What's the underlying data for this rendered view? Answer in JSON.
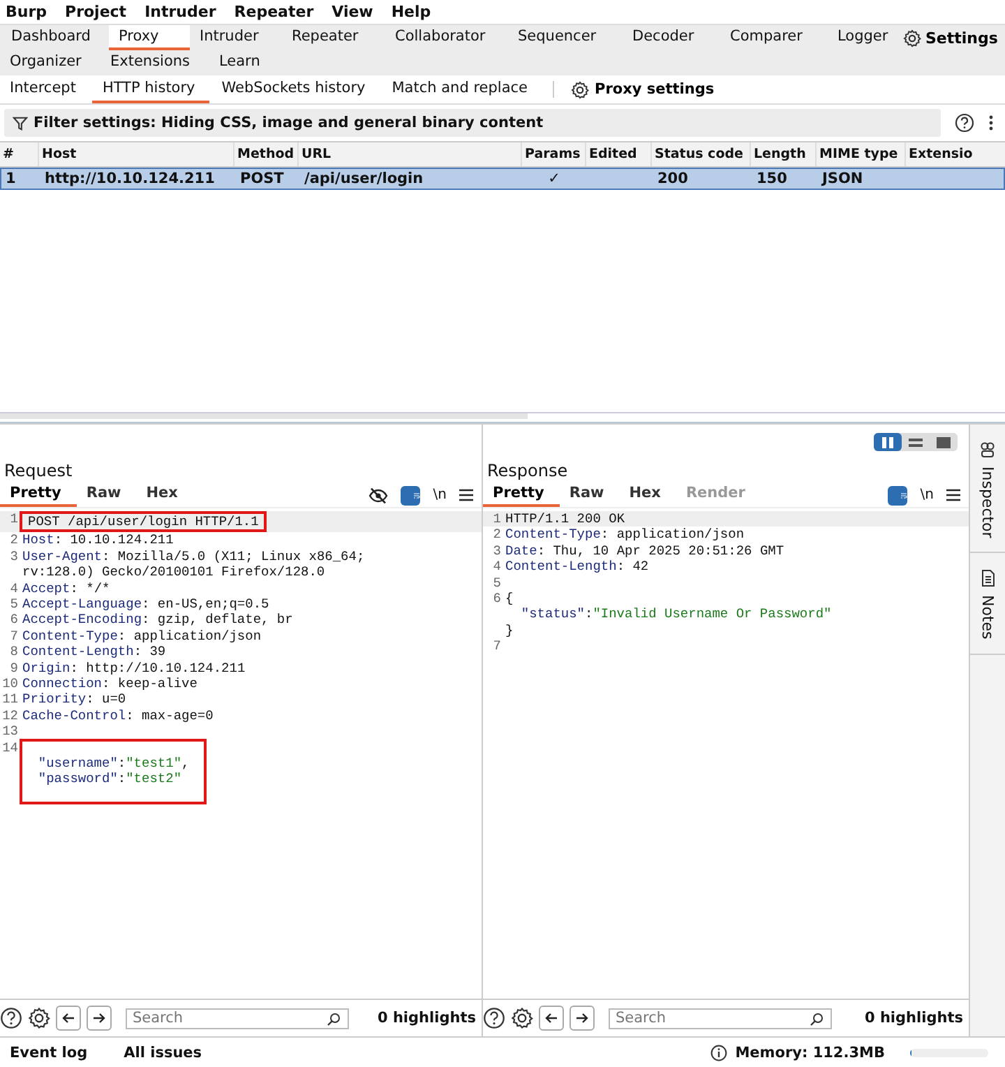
{
  "menu": [
    "Burp",
    "Project",
    "Intruder",
    "Repeater",
    "View",
    "Help"
  ],
  "tab_rows": [
    [
      {
        "label": "Dashboard",
        "selected": false
      },
      {
        "label": "Proxy",
        "selected": true
      },
      {
        "label": "Intruder",
        "selected": false
      },
      {
        "label": "Repeater",
        "selected": false
      },
      {
        "label": "Collaborator",
        "selected": false
      },
      {
        "label": "Sequencer",
        "selected": false
      },
      {
        "label": "Decoder",
        "selected": false
      },
      {
        "label": "Comparer",
        "selected": false
      },
      {
        "label": "Logger",
        "selected": false
      }
    ],
    [
      {
        "label": "Organizer",
        "selected": false
      },
      {
        "label": "Extensions",
        "selected": false
      },
      {
        "label": "Learn",
        "selected": false
      }
    ]
  ],
  "settings_button": {
    "label": "Settings"
  },
  "sub_tabs": [
    {
      "label": "Intercept",
      "selected": false
    },
    {
      "label": "HTTP history",
      "selected": true
    },
    {
      "label": "WebSockets history",
      "selected": false
    },
    {
      "label": "Match and replace",
      "selected": false
    }
  ],
  "proxy_settings_button": {
    "label": "Proxy settings"
  },
  "filter": {
    "text": "Filter settings: Hiding CSS, image and general binary content"
  },
  "table": {
    "columns": [
      "#",
      "Host",
      "Method",
      "URL",
      "Params",
      "Edited",
      "Status code",
      "Length",
      "MIME type",
      "Extensio"
    ],
    "rows": [
      {
        "selected": true,
        "cells": [
          "1",
          "http://10.10.124.211",
          "POST",
          "/api/user/login",
          "✓",
          "",
          "200",
          "150",
          "JSON",
          ""
        ]
      }
    ]
  },
  "panes": [
    {
      "title": "Request",
      "tabs": [
        {
          "label": "Pretty",
          "selected": true,
          "disabled": false
        },
        {
          "label": "Raw",
          "selected": false,
          "disabled": false
        },
        {
          "label": "Hex",
          "selected": false,
          "disabled": false
        }
      ],
      "hide_icon": true,
      "newline_label": "\\n",
      "lines": [
        {
          "n": "1",
          "current": true,
          "boxed": true,
          "rows": [
            {
              "indented": false,
              "segments": [
                {
                  "kind": "plain",
                  "text": "POST /api/user/login HTTP/1.1"
                }
              ]
            }
          ]
        },
        {
          "n": "2",
          "current": false,
          "boxed": false,
          "rows": [
            {
              "indented": false,
              "segments": [
                {
                  "kind": "key",
                  "text": "Host"
                },
                {
                  "kind": "plain",
                  "text": ": 10.10.124.211"
                }
              ]
            }
          ]
        },
        {
          "n": "3",
          "current": false,
          "boxed": false,
          "rows": [
            {
              "indented": false,
              "segments": [
                {
                  "kind": "key",
                  "text": "User-Agent"
                },
                {
                  "kind": "plain",
                  "text": ": Mozilla/5.0 (X11; Linux x86_64;"
                }
              ]
            },
            {
              "indented": false,
              "segments": [
                {
                  "kind": "plain",
                  "text": "rv:128.0) Gecko/20100101 Firefox/128.0"
                }
              ]
            }
          ]
        },
        {
          "n": "4",
          "current": false,
          "boxed": false,
          "rows": [
            {
              "indented": false,
              "segments": [
                {
                  "kind": "key",
                  "text": "Accept"
                },
                {
                  "kind": "plain",
                  "text": ": */*"
                }
              ]
            }
          ]
        },
        {
          "n": "5",
          "current": false,
          "boxed": false,
          "rows": [
            {
              "indented": false,
              "segments": [
                {
                  "kind": "key",
                  "text": "Accept-Language"
                },
                {
                  "kind": "plain",
                  "text": ": en-US,en;q=0.5"
                }
              ]
            }
          ]
        },
        {
          "n": "6",
          "current": false,
          "boxed": false,
          "rows": [
            {
              "indented": false,
              "segments": [
                {
                  "kind": "key",
                  "text": "Accept-Encoding"
                },
                {
                  "kind": "plain",
                  "text": ": gzip, deflate, br"
                }
              ]
            }
          ]
        },
        {
          "n": "7",
          "current": false,
          "boxed": false,
          "rows": [
            {
              "indented": false,
              "segments": [
                {
                  "kind": "key",
                  "text": "Content-Type"
                },
                {
                  "kind": "plain",
                  "text": ": application/json"
                }
              ]
            }
          ]
        },
        {
          "n": "8",
          "current": false,
          "boxed": false,
          "rows": [
            {
              "indented": false,
              "segments": [
                {
                  "kind": "key",
                  "text": "Content-Length"
                },
                {
                  "kind": "plain",
                  "text": ": 39"
                }
              ]
            }
          ]
        },
        {
          "n": "9",
          "current": false,
          "boxed": false,
          "rows": [
            {
              "indented": false,
              "segments": [
                {
                  "kind": "key",
                  "text": "Origin"
                },
                {
                  "kind": "plain",
                  "text": ": http://10.10.124.211"
                }
              ]
            }
          ]
        },
        {
          "n": "10",
          "current": false,
          "boxed": false,
          "rows": [
            {
              "indented": false,
              "segments": [
                {
                  "kind": "key",
                  "text": "Connection"
                },
                {
                  "kind": "plain",
                  "text": ": keep-alive"
                }
              ]
            }
          ]
        },
        {
          "n": "11",
          "current": false,
          "boxed": false,
          "rows": [
            {
              "indented": false,
              "segments": [
                {
                  "kind": "key",
                  "text": "Priority"
                },
                {
                  "kind": "plain",
                  "text": ": u=0"
                }
              ]
            }
          ]
        },
        {
          "n": "12",
          "current": false,
          "boxed": false,
          "rows": [
            {
              "indented": false,
              "segments": [
                {
                  "kind": "key",
                  "text": "Cache-Control"
                },
                {
                  "kind": "plain",
                  "text": ": max-age=0"
                }
              ]
            }
          ]
        },
        {
          "n": "13",
          "current": false,
          "boxed": false
        },
        {
          "n": "14",
          "current": false,
          "boxed": true,
          "rows": [
            {
              "indented": true,
              "segments": [
                {
                  "kind": "jkey",
                  "text": "\"username\""
                },
                {
                  "kind": "plain",
                  "text": ":"
                },
                {
                  "kind": "jstr",
                  "text": "\"test1\""
                },
                {
                  "kind": "plain",
                  "text": ","
                }
              ]
            },
            {
              "indented": true,
              "segments": [
                {
                  "kind": "jkey",
                  "text": "\"password\""
                },
                {
                  "kind": "plain",
                  "text": ":"
                },
                {
                  "kind": "jstr",
                  "text": "\"test2\""
                }
              ]
            }
          ]
        }
      ],
      "search_placeholder": "Search",
      "highlights": "0 highlights"
    },
    {
      "title": "Response",
      "tabs": [
        {
          "label": "Pretty",
          "selected": true,
          "disabled": false
        },
        {
          "label": "Raw",
          "selected": false,
          "disabled": false
        },
        {
          "label": "Hex",
          "selected": false,
          "disabled": false
        },
        {
          "label": "Render",
          "selected": false,
          "disabled": true
        }
      ],
      "hide_icon": false,
      "newline_label": "\\n",
      "lines": [
        {
          "n": "1",
          "current": true,
          "boxed": false,
          "rows": [
            {
              "indented": false,
              "segments": [
                {
                  "kind": "plain",
                  "text": "HTTP/1.1 200 OK"
                }
              ]
            }
          ]
        },
        {
          "n": "2",
          "current": false,
          "boxed": false,
          "rows": [
            {
              "indented": false,
              "segments": [
                {
                  "kind": "key",
                  "text": "Content-Type"
                },
                {
                  "kind": "plain",
                  "text": ": application/json"
                }
              ]
            }
          ]
        },
        {
          "n": "3",
          "current": false,
          "boxed": false,
          "rows": [
            {
              "indented": false,
              "segments": [
                {
                  "kind": "key",
                  "text": "Date"
                },
                {
                  "kind": "plain",
                  "text": ": Thu, 10 Apr 2025 20:51:26 GMT"
                }
              ]
            }
          ]
        },
        {
          "n": "4",
          "current": false,
          "boxed": false,
          "rows": [
            {
              "indented": false,
              "segments": [
                {
                  "kind": "key",
                  "text": "Content-Length"
                },
                {
                  "kind": "plain",
                  "text": ": 42"
                }
              ]
            }
          ]
        },
        {
          "n": "5",
          "current": false,
          "boxed": false
        },
        {
          "n": "6",
          "current": false,
          "boxed": false,
          "rows": [
            {
              "indented": false,
              "segments": [
                {
                  "kind": "plain",
                  "text": "{"
                }
              ]
            },
            {
              "indented": true,
              "segments": [
                {
                  "kind": "jkey",
                  "text": "\"status\""
                },
                {
                  "kind": "plain",
                  "text": ":"
                },
                {
                  "kind": "jstr",
                  "text": "\"Invalid Username Or Password\""
                }
              ]
            },
            {
              "indented": false,
              "segments": [
                {
                  "kind": "plain",
                  "text": "}"
                }
              ]
            }
          ]
        },
        {
          "n": "7",
          "current": false,
          "boxed": false
        }
      ],
      "search_placeholder": "Search",
      "highlights": "0 highlights"
    }
  ],
  "layout_toggles": [
    {
      "selected": true
    },
    {
      "selected": false
    },
    {
      "selected": false
    }
  ],
  "side_tabs": [
    {
      "label": "Inspector"
    },
    {
      "label": "Notes"
    }
  ],
  "status_bar": {
    "links": [
      "Event log",
      "All issues"
    ],
    "memory": "Memory: 112.3MB",
    "level": 0.02
  }
}
